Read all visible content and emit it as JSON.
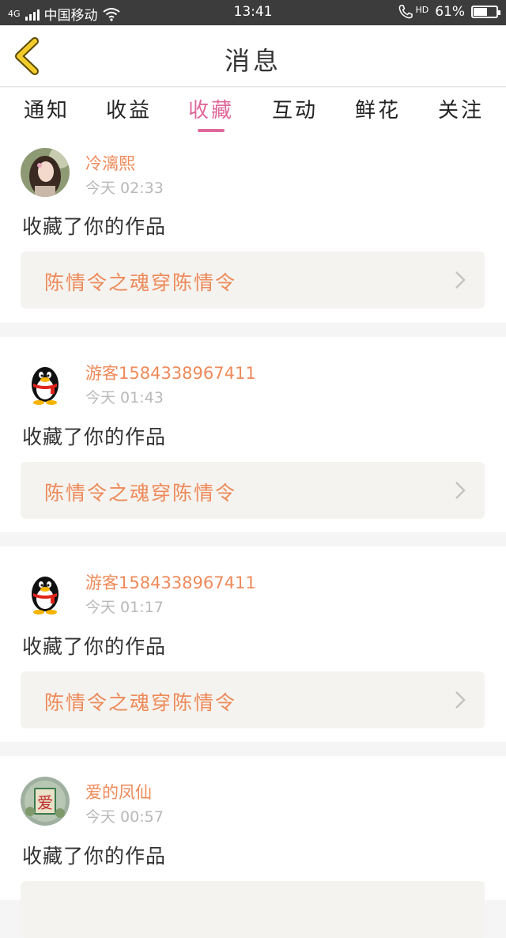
{
  "status_bar": {
    "network": "4G",
    "carrier": "中国移动",
    "time": "13:41",
    "hd": "HD",
    "battery_percent": "61%",
    "battery_level": 0.61
  },
  "header": {
    "back_icon": "chevron-left-icon",
    "title": "消息"
  },
  "tabs": [
    {
      "label": "通知"
    },
    {
      "label": "收益"
    },
    {
      "label": "收藏",
      "active": true
    },
    {
      "label": "互动"
    },
    {
      "label": "鲜花"
    },
    {
      "label": "关注"
    }
  ],
  "messages": [
    {
      "user": "冷漓熙",
      "time": "今天 02:33",
      "action": "收藏了你的作品",
      "work": "陈情令之魂穿陈情令",
      "avatar": "girl-portrait"
    },
    {
      "user": "游客1584338967411",
      "time": "今天 01:43",
      "action": "收藏了你的作品",
      "work": "陈情令之魂穿陈情令",
      "avatar": "penguin"
    },
    {
      "user": "游客1584338967411",
      "time": "今天 01:17",
      "action": "收藏了你的作品",
      "work": "陈情令之魂穿陈情令",
      "avatar": "penguin"
    },
    {
      "user": "爱的凤仙",
      "time": "今天 00:57",
      "action": "收藏了你的作品",
      "work": "",
      "avatar": "love-tile"
    }
  ],
  "colors": {
    "accent": "#e0689a",
    "username": "#ee8a5a",
    "link_bg": "#f4f3ef"
  }
}
